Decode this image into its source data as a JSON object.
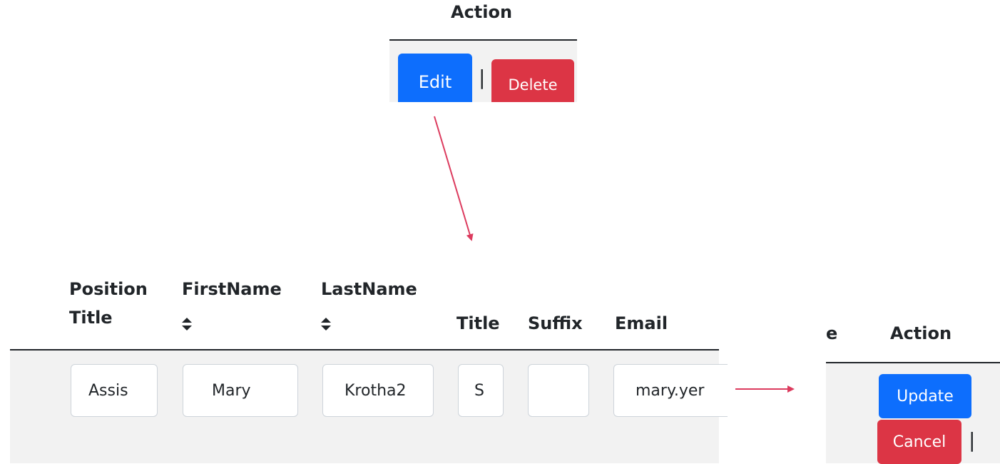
{
  "top_panel": {
    "header": "Action",
    "edit_label": "Edit",
    "separator": "|",
    "delete_label": "Delete"
  },
  "bottom_table": {
    "columns": [
      {
        "line1": "Position",
        "line2": "Title",
        "sortable": false
      },
      {
        "line1": "FirstName",
        "line2": "",
        "sortable": true
      },
      {
        "line1": "LastName",
        "line2": "",
        "sortable": true
      },
      {
        "line1": "",
        "line2": "Title",
        "sortable": false
      },
      {
        "line1": "",
        "line2": "Suffix",
        "sortable": false
      },
      {
        "line1": "",
        "line2": "Email",
        "sortable": false
      }
    ],
    "row": {
      "position_title": "Assis",
      "first_name": "Mary",
      "last_name": "Krotha2",
      "title": "S",
      "suffix": "",
      "email": "mary.yer"
    }
  },
  "right_panel": {
    "partial_header": "e",
    "header": "Action",
    "update_label": "Update",
    "cancel_label": "Cancel",
    "separator": "|"
  },
  "colors": {
    "primary": "#0d6efd",
    "danger": "#dc3545",
    "row_background": "#f2f2f2",
    "annotation_arrow": "#dc3b5e"
  }
}
